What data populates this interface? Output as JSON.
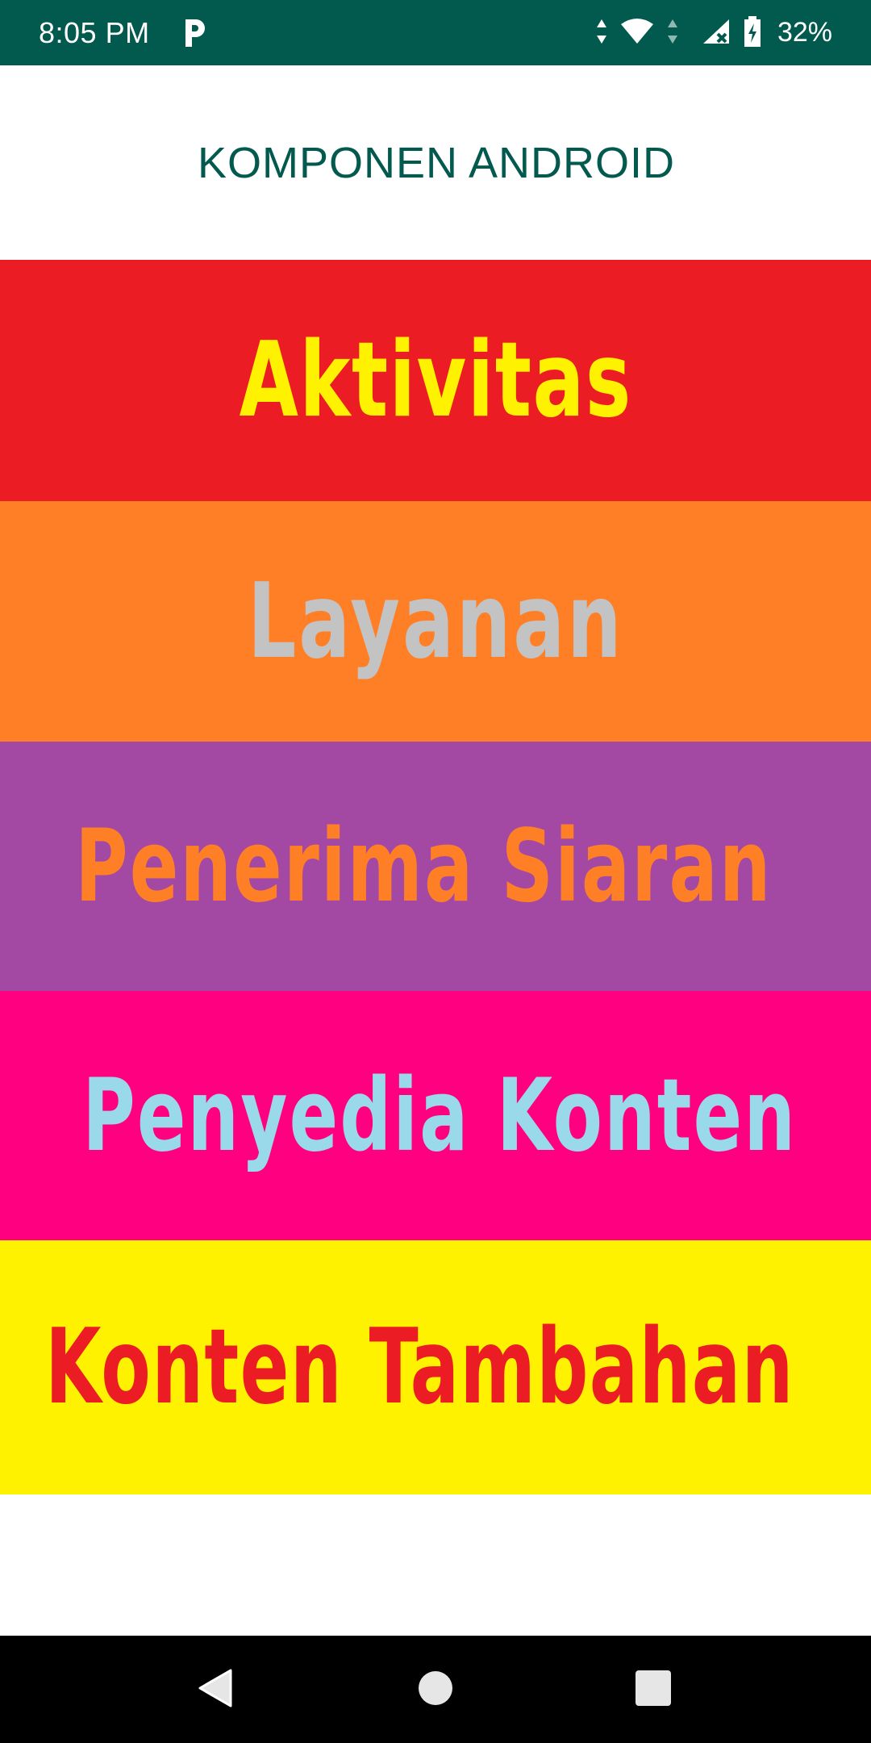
{
  "status_bar": {
    "time": "8:05 PM",
    "battery": "32%",
    "background_color": "#02594e",
    "icons": [
      "p-app-icon",
      "data-arrows-icon",
      "wifi-icon",
      "signal-icon",
      "battery-charging-icon"
    ]
  },
  "header": {
    "title": "KOMPONEN ANDROID",
    "color": "#02594e"
  },
  "components": [
    {
      "label": "Aktivitas",
      "background": "#ec1c24",
      "text_color": "#fff200"
    },
    {
      "label": "Layanan",
      "background": "#ff7f27",
      "text_color": "#c3c3c3"
    },
    {
      "label": "Penerima Siaran",
      "background": "#a349a4",
      "text_color": "#ff7f27"
    },
    {
      "label": "Penyedia Konten",
      "background": "#ff0080",
      "text_color": "#99d9ea"
    },
    {
      "label": "Konten Tambahan",
      "background": "#fff200",
      "text_color": "#ec1c24"
    }
  ],
  "nav_bar": {
    "icons": [
      "back-icon",
      "home-icon",
      "recents-icon"
    ]
  }
}
